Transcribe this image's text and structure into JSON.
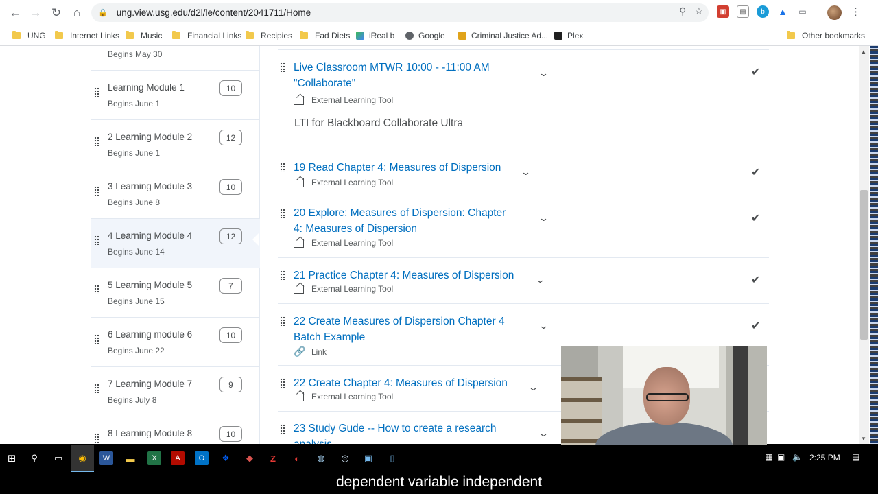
{
  "browser": {
    "url": "ung.view.usg.edu/d2l/le/content/2041711/Home",
    "bookmarks": [
      "UNG",
      "Internet Links",
      "Music",
      "Financial Links",
      "Recipies",
      "Fad Diets",
      "iReal b",
      "Google",
      "Criminal Justice Ad...",
      "Plex",
      "Other bookmarks"
    ]
  },
  "sidebar": {
    "partial_item": {
      "date": "Begins May 30"
    },
    "modules": [
      {
        "title": "Learning Module 1",
        "date": "Begins June 1",
        "count": "10"
      },
      {
        "title": "2 Learning Module 2",
        "date": "Begins June 1",
        "count": "12"
      },
      {
        "title": "3 Learning Module 3",
        "date": "Begins June 8",
        "count": "10"
      },
      {
        "title": "4 Learning Module 4",
        "date": "Begins June 14",
        "count": "12"
      },
      {
        "title": "5 Learning Module 5",
        "date": "Begins June 15",
        "count": "7"
      },
      {
        "title": "6 Learning module 6",
        "date": "Begins June 22",
        "count": "10"
      },
      {
        "title": "7 Learning Module 7",
        "date": "Begins July 8",
        "count": "9"
      },
      {
        "title": "8 Learning Module 8",
        "date": "",
        "count": "10"
      }
    ]
  },
  "topics": [
    {
      "title_line1": "Live Classroom MTWR 10:00 - -11:00 AM",
      "title_line2": "\"Collaborate\"",
      "type": "External Learning Tool",
      "description": "LTI for Blackboard Collaborate Ultra"
    },
    {
      "title_line1": "19 Read Chapter 4: Measures of Dispersion",
      "title_line2": "",
      "type": "External Learning Tool"
    },
    {
      "title_line1": "20 Explore: Measures of Dispersion: Chapter",
      "title_line2": "4: Measures of Dispersion",
      "type": "External Learning Tool"
    },
    {
      "title_line1": "21 Practice Chapter 4: Measures of Dispersion",
      "title_line2": "",
      "type": "External Learning Tool"
    },
    {
      "title_line1": "22 Create Measures of Dispersion Chapter 4",
      "title_line2": "Batch Example",
      "type": "Link"
    },
    {
      "title_line1": "22 Create Chapter 4: Measures of Dispersion",
      "title_line2": "",
      "type": "External Learning Tool"
    },
    {
      "title_line1": "23 Study Gude -- How to create a research",
      "title_line2": "analysis",
      "type": ""
    }
  ],
  "taskbar": {
    "clock": "2:25 PM"
  },
  "caption": "dependent variable independent",
  "colors": {
    "link": "#006fbf",
    "active_module_bg": "#f1f5fb"
  }
}
